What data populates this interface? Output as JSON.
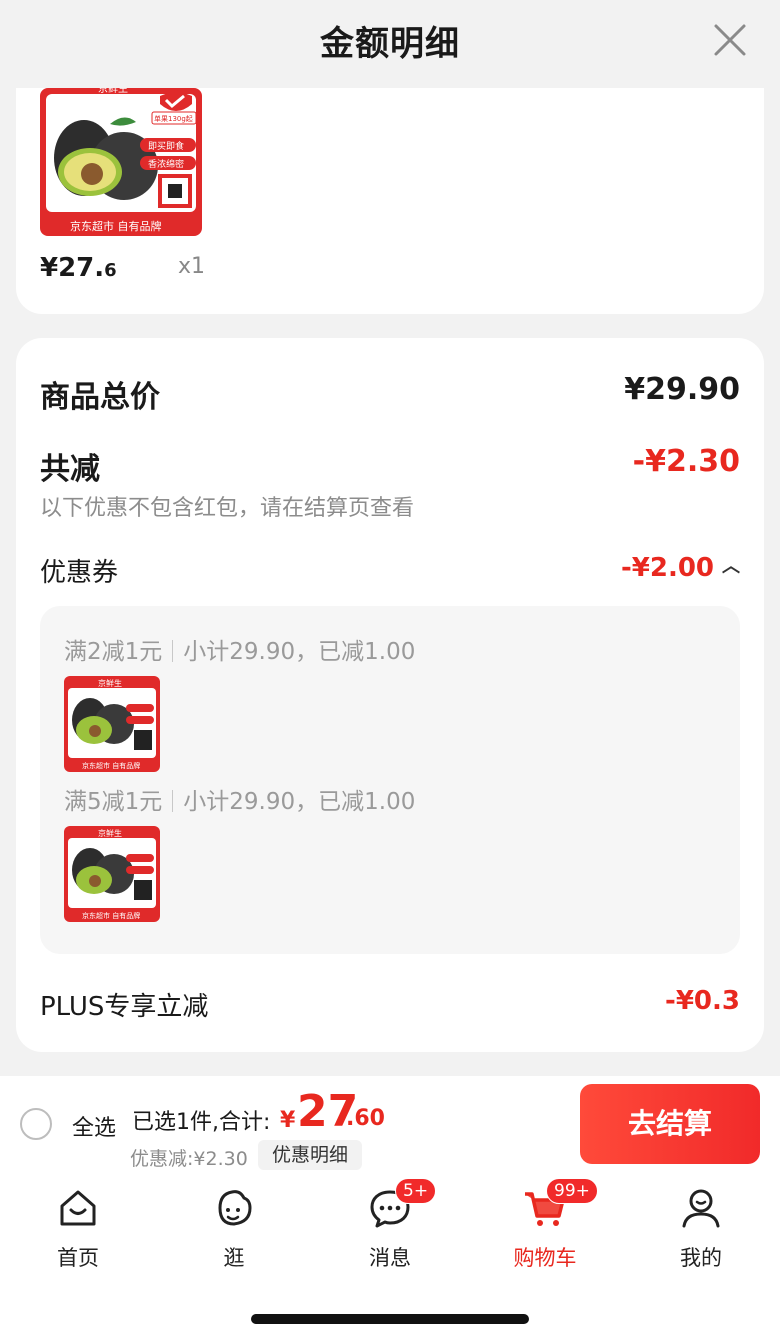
{
  "header": {
    "title": "金额明细"
  },
  "product": {
    "price_int": "¥27.",
    "price_dec": "6",
    "qty": "x1",
    "thumb_brand": "京鲜生",
    "thumb_tag1": "即买即食",
    "thumb_tag2": "香浓绵密",
    "thumb_footer": "京东超市 自有品牌",
    "thumb_weight": "单果130g起"
  },
  "summary": {
    "total_label": "商品总价",
    "total_value": "¥29.90",
    "reduce_label": "共减",
    "reduce_value": "-¥2.30",
    "reduce_note": "以下优惠不包含红包，请在结算页查看",
    "coupon_label": "优惠券",
    "coupon_value": "-¥2.00",
    "coupon_items": [
      {
        "rule": "满2减1元",
        "detail": "小计29.90，已减1.00"
      },
      {
        "rule": "满5减1元",
        "detail": "小计29.90，已减1.00"
      }
    ],
    "plus_label": "PLUS专享立减",
    "plus_value": "-¥0.3"
  },
  "checkout": {
    "select_all": "全选",
    "selected_info": "已选1件,合计:",
    "total_symbol": "¥",
    "total_int": "27",
    "total_dec": ".60",
    "discount": "优惠减:¥2.30",
    "detail_btn": "优惠明细",
    "go_btn": "去结算"
  },
  "tabs": [
    {
      "label": "首页",
      "icon": "home-icon"
    },
    {
      "label": "逛",
      "icon": "browse-icon"
    },
    {
      "label": "消息",
      "icon": "message-icon",
      "badge": "5+"
    },
    {
      "label": "购物车",
      "icon": "cart-icon",
      "badge": "99+",
      "active": true
    },
    {
      "label": "我的",
      "icon": "profile-icon"
    }
  ],
  "colors": {
    "accent": "#e8281f",
    "background": "#f2f2f2"
  }
}
